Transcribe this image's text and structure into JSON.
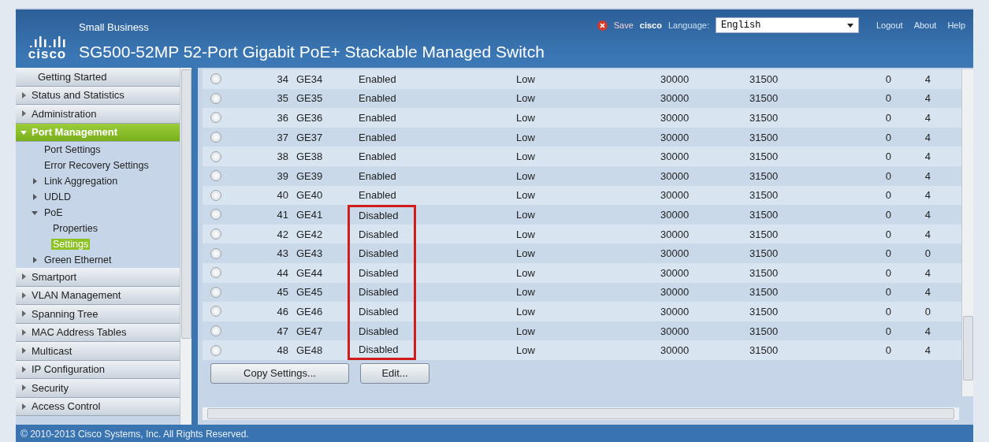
{
  "header": {
    "logo_text": "cisco",
    "brand": "Small Business",
    "title": "SG500-52MP 52-Port Gigabit PoE+ Stackable Managed Switch",
    "save": "Save",
    "user": "cisco",
    "language_label": "Language:",
    "language": "English",
    "links": [
      "Logout",
      "About",
      "Help"
    ]
  },
  "sidebar": {
    "items": [
      {
        "label": "Getting Started",
        "selected": false
      },
      {
        "label": "Status and Statistics",
        "expanded": false,
        "selected": false
      },
      {
        "label": "Administration",
        "expanded": false,
        "selected": false
      },
      {
        "label": "Port Management",
        "expanded": true,
        "selected": true,
        "children": [
          {
            "label": "Port Settings",
            "selected": false
          },
          {
            "label": "Error Recovery Settings",
            "selected": false
          },
          {
            "label": "Link Aggregation",
            "expanded": false,
            "selected": false
          },
          {
            "label": "UDLD",
            "expanded": false,
            "selected": false
          },
          {
            "label": "PoE",
            "expanded": true,
            "selected": false,
            "children": [
              {
                "label": "Properties",
                "selected": false
              },
              {
                "label": "Settings",
                "selected": true
              }
            ]
          },
          {
            "label": "Green Ethernet",
            "expanded": false,
            "selected": false
          }
        ]
      },
      {
        "label": "Smartport",
        "expanded": false,
        "selected": false
      },
      {
        "label": "VLAN Management",
        "expanded": false,
        "selected": false
      },
      {
        "label": "Spanning Tree",
        "expanded": false,
        "selected": false
      },
      {
        "label": "MAC Address Tables",
        "expanded": false,
        "selected": false
      },
      {
        "label": "Multicast",
        "expanded": false,
        "selected": false
      },
      {
        "label": "IP Configuration",
        "expanded": false,
        "selected": false
      },
      {
        "label": "Security",
        "expanded": false,
        "selected": false
      },
      {
        "label": "Access Control",
        "expanded": false,
        "selected": false
      }
    ]
  },
  "table": {
    "rows": [
      {
        "selected": false,
        "highlighted": false,
        "cells": [
          "34",
          "GE34",
          "Enabled",
          "Low",
          "30000",
          "31500",
          "0",
          "4"
        ]
      },
      {
        "selected": false,
        "highlighted": false,
        "cells": [
          "35",
          "GE35",
          "Enabled",
          "Low",
          "30000",
          "31500",
          "0",
          "4"
        ]
      },
      {
        "selected": false,
        "highlighted": false,
        "cells": [
          "36",
          "GE36",
          "Enabled",
          "Low",
          "30000",
          "31500",
          "0",
          "4"
        ]
      },
      {
        "selected": false,
        "highlighted": false,
        "cells": [
          "37",
          "GE37",
          "Enabled",
          "Low",
          "30000",
          "31500",
          "0",
          "4"
        ]
      },
      {
        "selected": false,
        "highlighted": false,
        "cells": [
          "38",
          "GE38",
          "Enabled",
          "Low",
          "30000",
          "31500",
          "0",
          "4"
        ]
      },
      {
        "selected": false,
        "highlighted": false,
        "cells": [
          "39",
          "GE39",
          "Enabled",
          "Low",
          "30000",
          "31500",
          "0",
          "4"
        ]
      },
      {
        "selected": false,
        "highlighted": false,
        "cells": [
          "40",
          "GE40",
          "Enabled",
          "Low",
          "30000",
          "31500",
          "0",
          "4"
        ]
      },
      {
        "selected": false,
        "highlighted": true,
        "cells": [
          "41",
          "GE41",
          "Disabled",
          "Low",
          "30000",
          "31500",
          "0",
          "4"
        ]
      },
      {
        "selected": false,
        "highlighted": true,
        "cells": [
          "42",
          "GE42",
          "Disabled",
          "Low",
          "30000",
          "31500",
          "0",
          "4"
        ]
      },
      {
        "selected": false,
        "highlighted": true,
        "cells": [
          "43",
          "GE43",
          "Disabled",
          "Low",
          "30000",
          "31500",
          "0",
          "0"
        ]
      },
      {
        "selected": false,
        "highlighted": true,
        "cells": [
          "44",
          "GE44",
          "Disabled",
          "Low",
          "30000",
          "31500",
          "0",
          "4"
        ]
      },
      {
        "selected": false,
        "highlighted": true,
        "cells": [
          "45",
          "GE45",
          "Disabled",
          "Low",
          "30000",
          "31500",
          "0",
          "4"
        ]
      },
      {
        "selected": false,
        "highlighted": true,
        "cells": [
          "46",
          "GE46",
          "Disabled",
          "Low",
          "30000",
          "31500",
          "0",
          "0"
        ]
      },
      {
        "selected": false,
        "highlighted": true,
        "cells": [
          "47",
          "GE47",
          "Disabled",
          "Low",
          "30000",
          "31500",
          "0",
          "4"
        ]
      },
      {
        "selected": false,
        "highlighted": true,
        "cells": [
          "48",
          "GE48",
          "Disabled",
          "Low",
          "30000",
          "31500",
          "0",
          "4"
        ]
      }
    ],
    "buttons": [
      "Copy Settings...",
      "Edit..."
    ]
  },
  "footer": "© 2010-2013 Cisco Systems, Inc. All Rights Reserved."
}
